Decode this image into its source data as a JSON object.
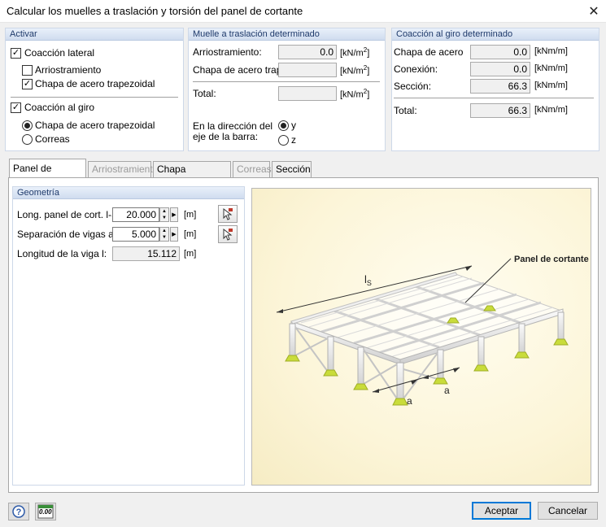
{
  "window": {
    "title": "Calcular los muelles a traslación y torsión del panel de cortante"
  },
  "activar": {
    "header": "Activar",
    "coaccion_lateral": {
      "label": "Coacción lateral",
      "checked": true
    },
    "arriostramiento": {
      "label": "Arriostramiento",
      "checked": false
    },
    "chapa_trapezoidal": {
      "label": "Chapa de acero trapezoidal",
      "checked": true
    },
    "coaccion_giro": {
      "label": "Coacción al giro",
      "checked": true
    },
    "radio_chapa": {
      "label": "Chapa de acero trapezoidal",
      "selected": true
    },
    "radio_correas": {
      "label": "Correas",
      "selected": false
    }
  },
  "muelle": {
    "header": "Muelle a traslación determinado",
    "rows": [
      {
        "label": "Arriostramiento:",
        "value": "0.0",
        "unit": "[kN/m",
        "unit_sup": "2",
        "unit_end": "]"
      },
      {
        "label": "Chapa de acero trap.:",
        "value": "",
        "unit": "[kN/m",
        "unit_sup": "2",
        "unit_end": "]"
      }
    ],
    "total": {
      "label": "Total:",
      "value": "",
      "unit": "[kN/m",
      "unit_sup": "2",
      "unit_end": "]"
    },
    "direccion_label_1": "En la dirección del",
    "direccion_label_2": "eje de la barra:",
    "radio_y": {
      "label": "y",
      "selected": true
    },
    "radio_z": {
      "label": "z",
      "selected": false
    }
  },
  "giro": {
    "header": "Coacción al giro determinado",
    "rows": [
      {
        "label": "Chapa de acero",
        "value": "0.0",
        "unit": "[kNm/m]"
      },
      {
        "label": "Conexión:",
        "value": "0.0",
        "unit": "[kNm/m]"
      },
      {
        "label": "Sección:",
        "value": "66.3",
        "unit": "[kNm/m]"
      }
    ],
    "total": {
      "label": "Total:",
      "value": "66.3",
      "unit": "[kNm/m]"
    }
  },
  "tabs": [
    {
      "label": "Panel de cortante",
      "state": "active"
    },
    {
      "label": "Arriostramiento",
      "state": "disabled"
    },
    {
      "label": "Chapa trapezoidal",
      "state": "normal"
    },
    {
      "label": "Correas",
      "state": "disabled"
    },
    {
      "label": "Sección",
      "state": "normal"
    }
  ],
  "geometria": {
    "header": "Geometría",
    "long_panel": {
      "label": "Long. panel de cort. l-S:",
      "value": "20.000",
      "unit": "[m]"
    },
    "separacion": {
      "label": "Separación de vigas a:",
      "value": "5.000",
      "unit": "[m]"
    },
    "longitud_viga": {
      "label": "Longitud de la viga l:",
      "value": "15.112",
      "unit": "[m]"
    }
  },
  "graphic": {
    "callout": "Panel de cortante",
    "dim_ls_main": "l",
    "dim_ls_sub": "S",
    "dim_a1": "a",
    "dim_a2": "a"
  },
  "footer": {
    "accept": "Aceptar",
    "cancel": "Cancelar",
    "units_icon_text": "0.00"
  },
  "colors": {
    "group_header_text": "#1f3a6b",
    "support_green": "#c9dc3a",
    "default_button_border": "#0078d7"
  }
}
